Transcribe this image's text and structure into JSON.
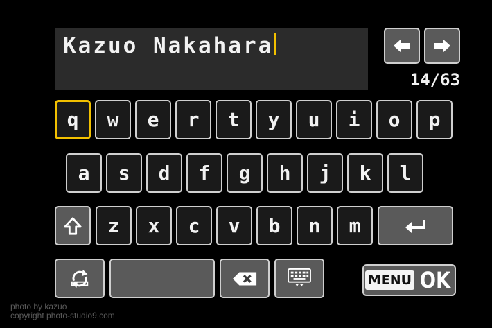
{
  "input": {
    "value": "Kazuo Nakahara",
    "char_count": "14/63"
  },
  "nav": {
    "left": "left-arrow-icon",
    "right": "right-arrow-icon"
  },
  "keyboard": {
    "row1": [
      "q",
      "w",
      "e",
      "r",
      "t",
      "y",
      "u",
      "i",
      "o",
      "p"
    ],
    "row2": [
      "a",
      "s",
      "d",
      "f",
      "g",
      "h",
      "j",
      "k",
      "l"
    ],
    "row3": [
      "z",
      "x",
      "c",
      "v",
      "b",
      "n",
      "m"
    ],
    "selected_key": "q"
  },
  "buttons": {
    "shift": "shift-icon",
    "enter": "enter-icon",
    "switch_mode": "switch-input-mode-icon",
    "space": "space-bar",
    "backspace": "backspace-icon",
    "hide_keyboard": "hide-keyboard-icon",
    "menu_label": "MENU",
    "ok_label": "OK"
  },
  "watermark": {
    "line1": "photo by kazuo",
    "line2": "copyright photo-studio9.com"
  },
  "colors": {
    "accent": "#f2c000",
    "key_bg": "#1a1a1a",
    "key_gray": "#5a5a5a",
    "border": "#cfcfcf"
  }
}
